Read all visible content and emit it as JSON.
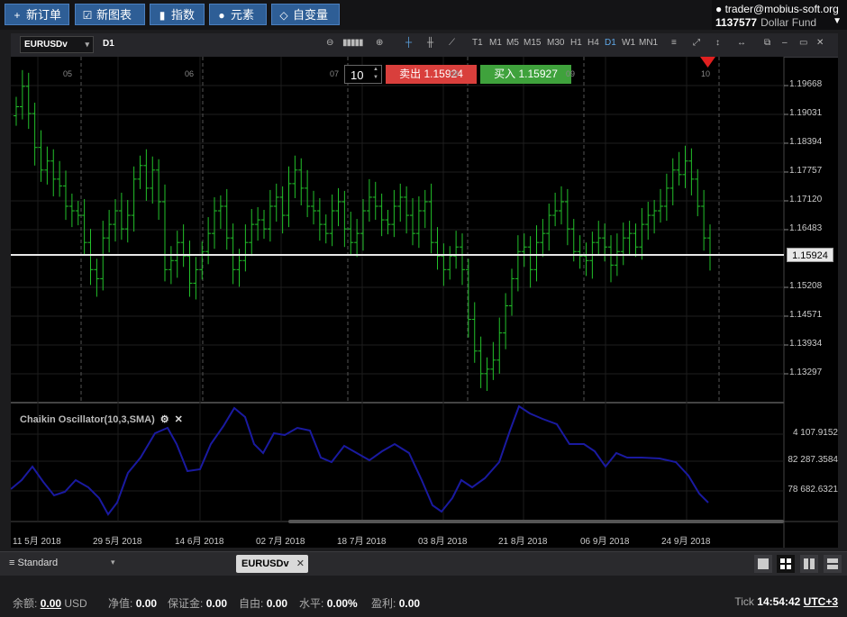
{
  "toolbar": {
    "new_order": "新订单",
    "new_chart": "新图表",
    "indices": "指数",
    "elements": "元素",
    "variables": "自变量"
  },
  "account": {
    "user": "trader@mobius-soft.org",
    "number": "1137577",
    "fund": "Dollar Fund"
  },
  "chart": {
    "symbol": "EURUSDv",
    "timeframe": "D1",
    "timeframes": [
      "T1",
      "M1",
      "M5",
      "M15",
      "M30",
      "H1",
      "H4",
      "D1",
      "W1",
      "MN1"
    ],
    "active_timeframe": "D1",
    "order_qty": "10",
    "sell_label": "卖出",
    "sell_price": "1.15924",
    "buy_label": "买入",
    "buy_price": "1.15927",
    "current_price": "1.15924",
    "price_levels": [
      "1.19668",
      "1.19031",
      "1.18394",
      "1.17757",
      "1.17120",
      "1.16483",
      "1.15208",
      "1.14571",
      "1.13934",
      "1.13297"
    ],
    "date_labels": [
      "11 5月 2018",
      "29 5月 2018",
      "14 6月 2018",
      "02 7月 2018",
      "18 7月 2018",
      "03 8月 2018",
      "21 8月 2018",
      "06 9月 2018",
      "24 9月 2018"
    ],
    "period_labels": [
      "05",
      "06",
      "07",
      "08",
      "09",
      "10"
    ],
    "indicator_title": "Chaikin Oscillator(10,3,SMA)",
    "oscillator_labels": [
      "4 107.9152",
      "82 287.3584",
      "78 682.6321"
    ]
  },
  "tabs": {
    "workspace": "Standard",
    "active_tab": "EURUSDv"
  },
  "status": {
    "balance_label": "余额:",
    "balance": "0.00",
    "currency": "USD",
    "equity_label": "净值:",
    "equity": "0.00",
    "margin_label": "保证金:",
    "margin": "0.00",
    "free_label": "自由:",
    "free": "0.00",
    "level_label": "水平:",
    "level": "0.00%",
    "profit_label": "盈利:",
    "profit": "0.00",
    "tick_label": "Tick",
    "time": "14:54:42",
    "timezone": "UTC+3"
  },
  "colors": {
    "button_blue": "#2e5e96",
    "sell_red": "#d93f3c",
    "buy_green": "#3fa23c",
    "bar_green": "#22c02a",
    "oscillator": "#1a1aa0"
  }
}
